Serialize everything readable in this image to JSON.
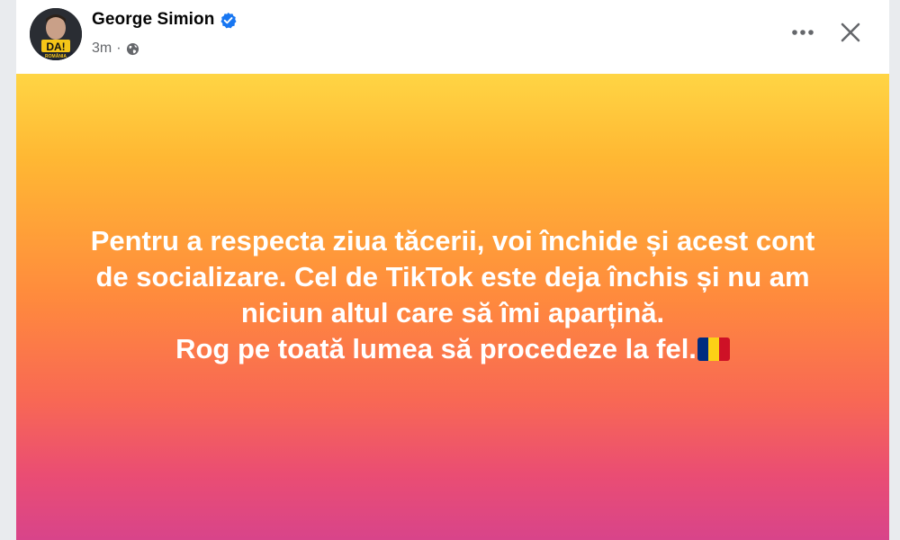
{
  "post": {
    "author": {
      "name": "George Simion",
      "verified": true,
      "avatar_text_main": "DA!",
      "avatar_text_sub": "ROMÂNIA"
    },
    "timestamp": "3m",
    "separator": "·",
    "audience_icon": "globe-icon",
    "menu_icon": "more-horizontal-icon",
    "close_icon": "close-icon",
    "text_lines": [
      "Pentru a respecta ziua tăcerii, voi închide și acest cont",
      "de socializare. Cel de TikTok este deja închis și nu am",
      "niciun altul care să îmi aparțină.",
      "Rog pe toată lumea să procedeze la fel."
    ],
    "trailing_emoji": "romania-flag-icon",
    "flag_colors": [
      "#002B7F",
      "#FCD116",
      "#CE1126"
    ],
    "background_colors": [
      "#ffd544",
      "#ff8a3d",
      "#d8448a"
    ],
    "verified_color": "#1877f2"
  }
}
